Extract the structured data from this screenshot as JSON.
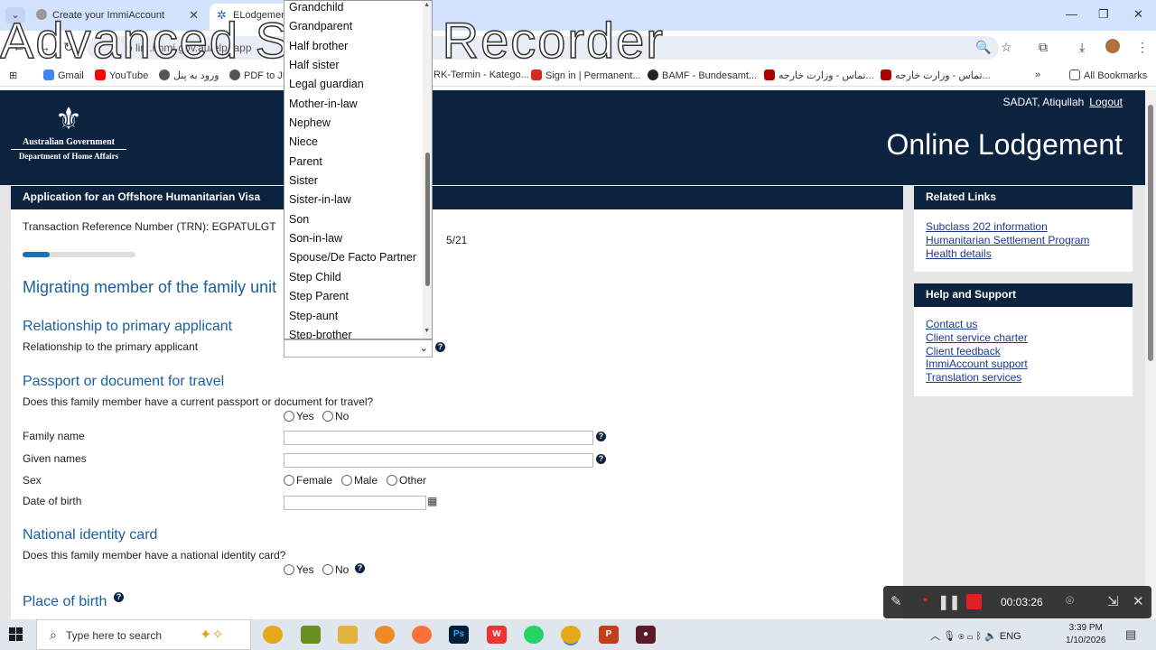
{
  "browser": {
    "tabs": [
      {
        "title": "Create your ImmiAccount"
      },
      {
        "title": "ELodgement"
      }
    ],
    "url": "o lin .immi.gov.au/elp/ app",
    "bookmarks": [
      "Gmail",
      "YouTube",
      "ورود به پنل",
      "PDF to JP",
      "RK-Termin - Katego...",
      "Sign in | Permanent...",
      "BAMF - Bundesamt...",
      "تماس - وزارت خارجه...",
      "تماس - وزارت خارجه...",
      "All Bookmarks"
    ]
  },
  "watermark": "Advanced Screen Recorder",
  "header": {
    "gov": "Australian Government",
    "dept": "Department of Home Affairs",
    "user": "SADAT, Atiqullah",
    "logout": "Logout",
    "title": "Online Lodgement"
  },
  "form": {
    "panel_title": "Application for an Offshore Humanitarian Visa",
    "trn": "Transaction Reference Number (TRN): EGPATULGT",
    "page_count": "5/21",
    "progress": 0.24,
    "section_title": "Migrating member of the family unit",
    "rel_heading": "Relationship to primary applicant",
    "rel_label": "Relationship to the primary applicant",
    "passport_heading": "Passport or document for travel",
    "passport_q": "Does this family member have a current passport or document for travel?",
    "yes": "Yes",
    "no": "No",
    "family_name": "Family name",
    "given_names": "Given names",
    "sex": "Sex",
    "female": "Female",
    "male": "Male",
    "other": "Other",
    "dob": "Date of birth",
    "nid_heading": "National identity card",
    "nid_q": "Does this family member have a national identity card?",
    "pob_heading": "Place of birth"
  },
  "dropdown": {
    "options": [
      "Grandchild",
      "Grandparent",
      "Half brother",
      "Half sister",
      "Legal guardian",
      "Mother-in-law",
      "Nephew",
      "Niece",
      "Parent",
      "Sister",
      "Sister-in-law",
      "Son",
      "Son-in-law",
      "Spouse/De Facto Partner",
      "Step Child",
      "Step Parent",
      "Step-aunt",
      "Step-brother"
    ]
  },
  "related_links": {
    "title": "Related Links",
    "links": [
      "Subclass 202 information",
      "Humanitarian Settlement Program",
      "Health details"
    ]
  },
  "help_support": {
    "title": "Help and Support",
    "links": [
      "Contact us",
      "Client service charter",
      "Client feedback",
      "ImmiAccount support",
      "Translation services"
    ]
  },
  "recorder": {
    "time": "00:03:26"
  },
  "taskbar": {
    "search_placeholder": "Type here to search",
    "lang": "ENG",
    "time": "3:39 PM",
    "date": "1/10/2026"
  }
}
